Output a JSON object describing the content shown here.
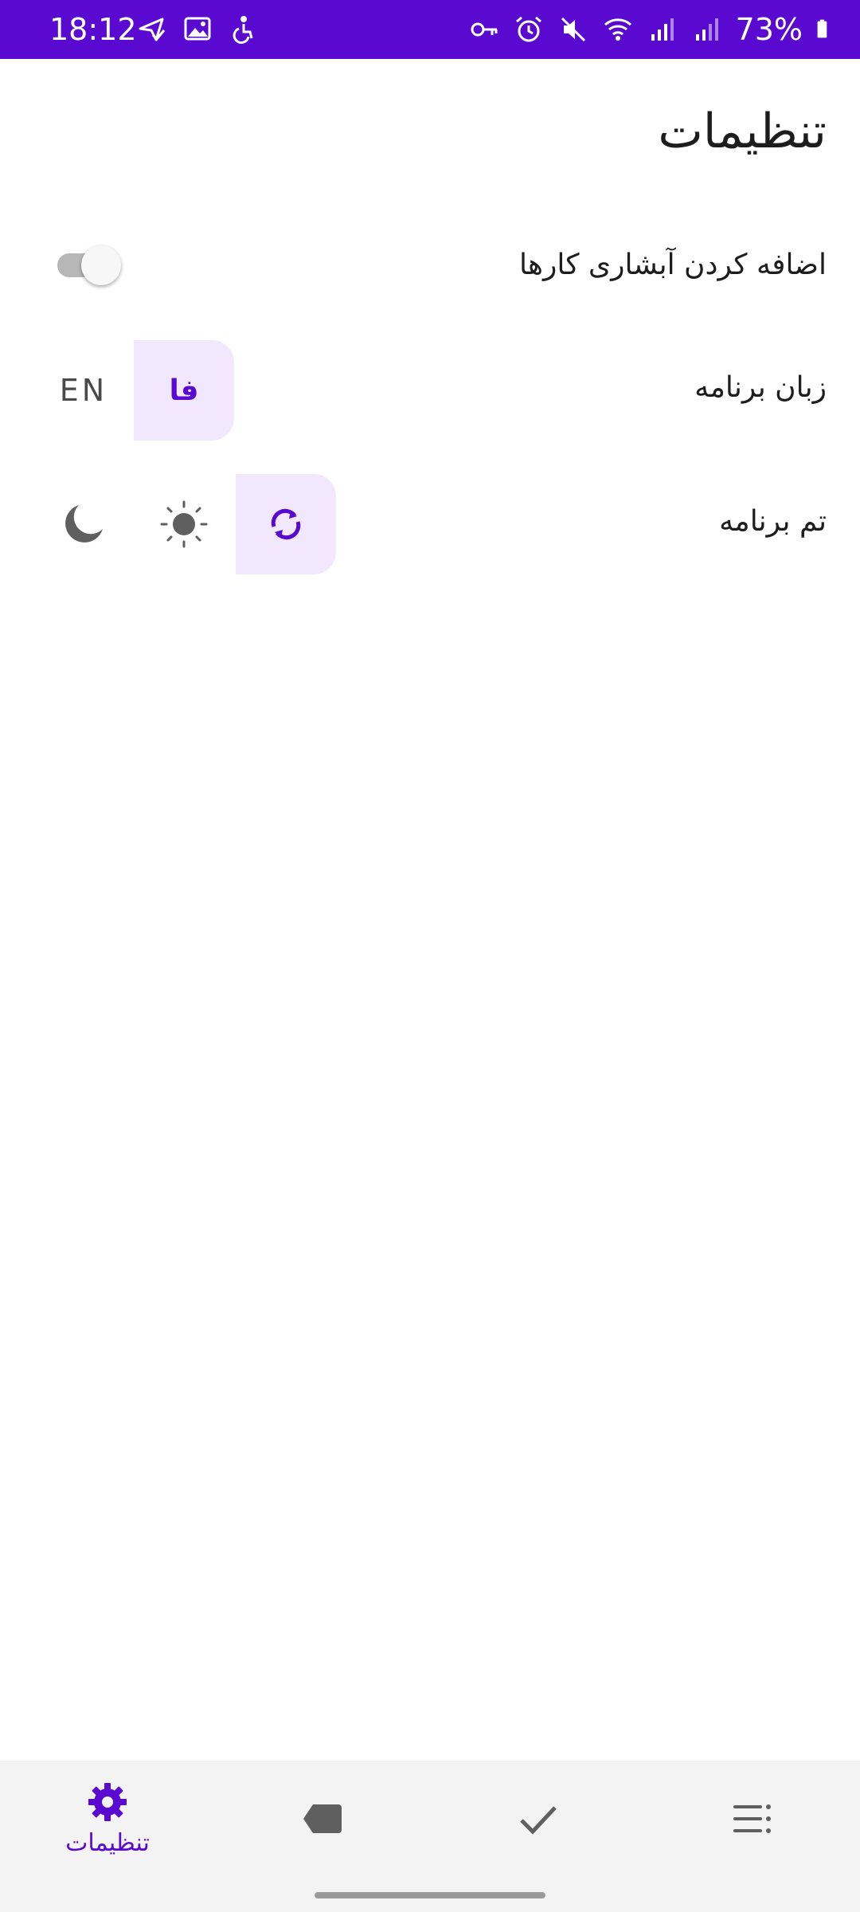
{
  "status_bar": {
    "time": "18:12",
    "battery": "73%",
    "left_icons": [
      "send-check-icon",
      "image-icon",
      "accessibility-icon"
    ],
    "right_icons": [
      "vpn-key-icon",
      "alarm-icon",
      "mute-icon",
      "wifi-icon",
      "signal-icon",
      "signal-icon",
      "battery-icon"
    ]
  },
  "page": {
    "title": "تنظیمات"
  },
  "settings": {
    "cascade_label": "اضافه کردن آبشاری کارها",
    "cascade_enabled": false,
    "language_label": "زبان برنامه",
    "language_options": [
      "فا",
      "EN"
    ],
    "language_selected": "فا",
    "theme_label": "تم برنامه",
    "theme_options": [
      "sync-icon",
      "sun-icon",
      "moon-icon"
    ],
    "theme_selected": "sync-icon"
  },
  "bottom_nav": {
    "items": [
      {
        "icon": "gear-icon",
        "label": "تنظیمات",
        "selected": true
      },
      {
        "icon": "label-tag-icon",
        "label": "",
        "selected": false
      },
      {
        "icon": "check-icon",
        "label": "",
        "selected": false
      },
      {
        "icon": "list-icon",
        "label": "",
        "selected": false
      }
    ]
  },
  "colors": {
    "accent": "#5a0ad0",
    "selected_bg": "#f1e8fd",
    "icon_gray": "#5f5f5f",
    "nav_bg": "#f3f3f3"
  }
}
